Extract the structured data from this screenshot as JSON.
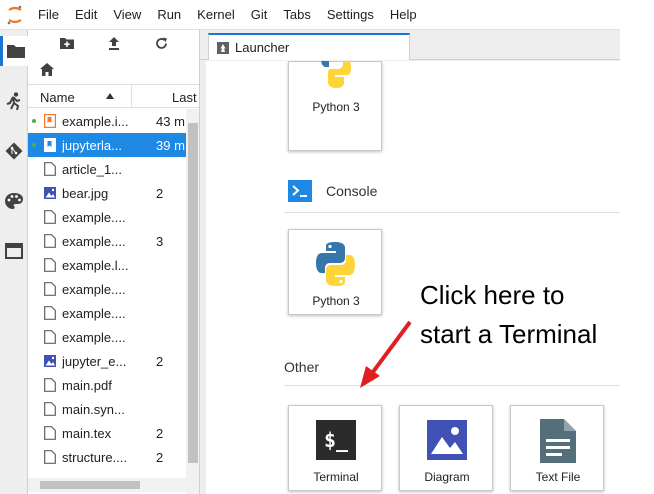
{
  "menubar": {
    "items": [
      "File",
      "Edit",
      "View",
      "Run",
      "Kernel",
      "Git",
      "Tabs",
      "Settings",
      "Help"
    ]
  },
  "activity": {
    "icons": [
      "folder-icon",
      "running-icon",
      "git-icon",
      "palette-icon",
      "tabs-icon"
    ]
  },
  "filebrowser": {
    "col_name": "Name",
    "col_last": "Last",
    "files": [
      {
        "name": "example.i...",
        "modified": "43 m",
        "type": "notebook",
        "running": true,
        "selected": false
      },
      {
        "name": "jupyterla...",
        "modified": "39 m",
        "type": "notebook-blue",
        "running": true,
        "selected": true
      },
      {
        "name": "article_1...",
        "modified": "",
        "type": "file",
        "running": false,
        "selected": false
      },
      {
        "name": "bear.jpg",
        "modified": "2",
        "type": "image",
        "running": false,
        "selected": false
      },
      {
        "name": "example....",
        "modified": "",
        "type": "file",
        "running": false,
        "selected": false
      },
      {
        "name": "example....",
        "modified": "3",
        "type": "file",
        "running": false,
        "selected": false
      },
      {
        "name": "example.l...",
        "modified": "",
        "type": "file",
        "running": false,
        "selected": false
      },
      {
        "name": "example....",
        "modified": "",
        "type": "file",
        "running": false,
        "selected": false
      },
      {
        "name": "example....",
        "modified": "",
        "type": "file",
        "running": false,
        "selected": false
      },
      {
        "name": "example....",
        "modified": "",
        "type": "file",
        "running": false,
        "selected": false
      },
      {
        "name": "jupyter_e...",
        "modified": "2",
        "type": "image",
        "running": false,
        "selected": false
      },
      {
        "name": "main.pdf",
        "modified": "",
        "type": "file",
        "running": false,
        "selected": false
      },
      {
        "name": "main.syn...",
        "modified": "",
        "type": "file",
        "running": false,
        "selected": false
      },
      {
        "name": "main.tex",
        "modified": "2",
        "type": "file",
        "running": false,
        "selected": false
      },
      {
        "name": "structure....",
        "modified": "2",
        "type": "file",
        "running": false,
        "selected": false
      }
    ]
  },
  "tab": {
    "label": "Launcher"
  },
  "launcher": {
    "notebook_card_label": "Python 3",
    "console_section": "Console",
    "console_card_label": "Python 3",
    "other_section": "Other",
    "other_cards": [
      "Terminal",
      "Diagram",
      "Text File"
    ]
  },
  "annotation": {
    "line1": "Click here to",
    "line2": "start a Terminal",
    "color": "#e02020"
  },
  "colors": {
    "accent": "#1976d2",
    "selection": "#1e88e5",
    "jupyter_orange": "#f37726",
    "python_blue": "#3776ab",
    "python_yellow": "#ffd43b",
    "running_green": "#4caf50"
  }
}
